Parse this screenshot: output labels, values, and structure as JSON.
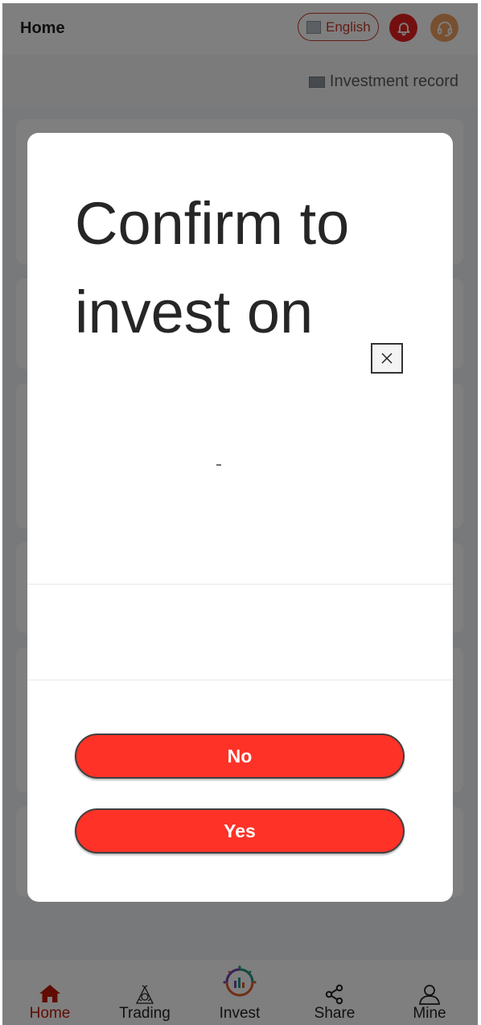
{
  "header": {
    "title": "Home",
    "language": "English",
    "record_link": "Investment record"
  },
  "modal": {
    "title": "Confirm to invest on",
    "subtitle": "-",
    "no_label": "No",
    "yes_label": "Yes"
  },
  "nav": {
    "items": [
      {
        "label": "Home",
        "icon": "home-icon",
        "active": true
      },
      {
        "label": "Trading",
        "icon": "trading-icon",
        "active": false
      },
      {
        "label": "Invest",
        "icon": "invest-icon",
        "active": false
      },
      {
        "label": "Share",
        "icon": "share-icon",
        "active": false
      },
      {
        "label": "Mine",
        "icon": "user-icon",
        "active": false
      }
    ]
  },
  "colors": {
    "accent": "#fe3227",
    "active_nav": "#c21807",
    "bell_bg": "#e6201e",
    "support_bg": "#eea062"
  }
}
